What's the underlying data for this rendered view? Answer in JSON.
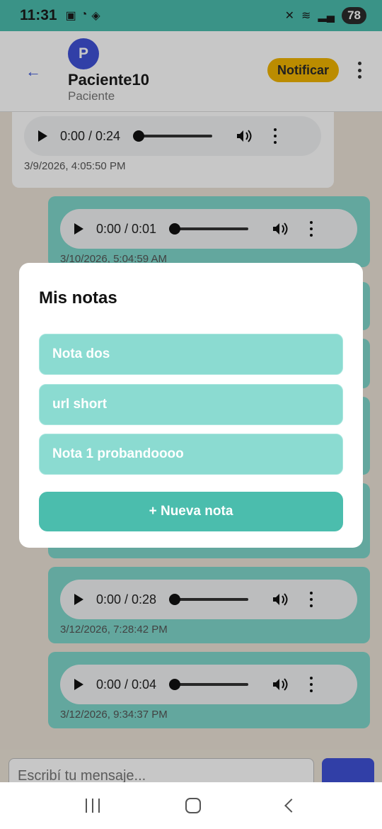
{
  "status_bar": {
    "time": "11:31",
    "battery": "78",
    "icons": [
      "screenshot-icon",
      "whatsapp-icon",
      "stack-icon",
      "mute-icon",
      "wifi-icon",
      "signal-icon"
    ]
  },
  "header": {
    "avatar_letter": "P",
    "name": "Paciente10",
    "role": "Paciente",
    "notify_label": "Notificar",
    "back_icon": "arrow-left-icon",
    "menu_icon": "more-vertical-icon",
    "accent_color": "#3f51d6",
    "notify_color": "#f0b400"
  },
  "messages": [
    {
      "direction": "in",
      "audio_time": "0:00 / 0:24",
      "timestamp": "3/9/2026, 4:05:50 PM"
    },
    {
      "direction": "out",
      "audio_time": "0:00 / 0:01",
      "timestamp": "3/10/2026, 5:04:59 AM"
    },
    {
      "direction": "out",
      "audio_time": "0:00 / 0:28",
      "timestamp": "3/12/2026, 7:28:42 PM"
    },
    {
      "direction": "out",
      "audio_time": "0:00 / 0:04",
      "timestamp": "3/12/2026, 9:34:37 PM"
    }
  ],
  "input": {
    "placeholder": "Escribí tu mensaje..."
  },
  "modal": {
    "title": "Mis notas",
    "notes": [
      "Nota dos",
      "url short",
      "Nota 1 probandoooo"
    ],
    "new_note_label": "+ Nueva nota",
    "note_color": "#8bdbd1",
    "button_color": "#4bbdad"
  }
}
